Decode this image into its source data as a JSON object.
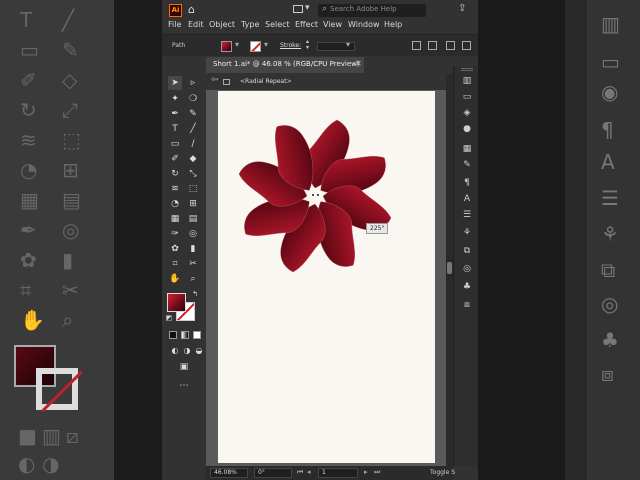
{
  "app": {
    "logo_text": "Ai",
    "help_search_placeholder": "Search Adobe Help"
  },
  "menu": {
    "items": [
      "File",
      "Edit",
      "Object",
      "Type",
      "Select",
      "Effect",
      "View",
      "Window",
      "Help"
    ]
  },
  "control_bar": {
    "selection_label": "Path",
    "stroke_label": "Stroke:",
    "stroke_value": ""
  },
  "document": {
    "tab_title": "Short 1.ai* @ 46.08 % (RGB/CPU Preview)",
    "breadcrumb": "<Radial Repeat>",
    "angle_tooltip": "225°"
  },
  "artwork": {
    "petal_count": 8,
    "gradient_from": "#d61c33",
    "gradient_to": "#2a0008"
  },
  "status": {
    "zoom": "46.08%",
    "rotation": "0°",
    "artboard_number": "1",
    "toggle_label": "Toggle S"
  },
  "colors": {
    "accent_red": "#c8182c",
    "ui_dark": "#323232",
    "canvas_gray": "#5a5a5a",
    "artboard": "#faf7f2"
  }
}
